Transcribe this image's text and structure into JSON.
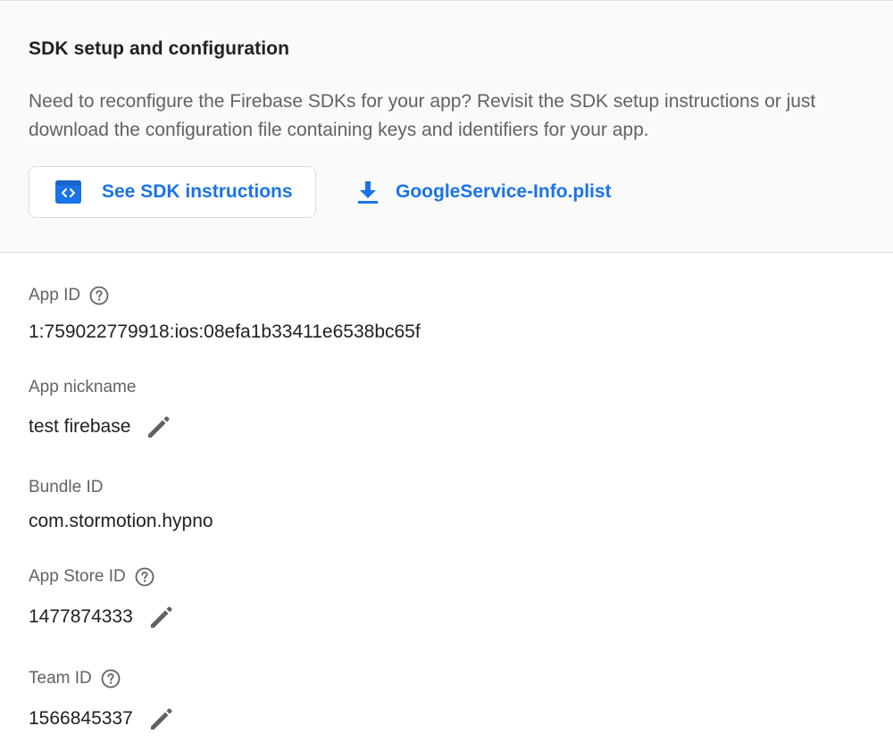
{
  "sdk_section": {
    "title": "SDK setup and configuration",
    "description": "Need to reconfigure the Firebase SDKs for your app? Revisit the SDK setup instructions or just download the configuration file containing keys and identifiers for your app.",
    "sdk_button_label": "See SDK instructions",
    "sdk_button_icon": "code-icon",
    "download_label": "GoogleService-Info.plist",
    "download_icon": "download-icon"
  },
  "fields": {
    "app_id": {
      "label": "App ID",
      "value": "1:759022779918:ios:08efa1b33411e6538bc65f",
      "help_icon": "help-icon"
    },
    "app_nickname": {
      "label": "App nickname",
      "value": "test firebase",
      "edit_icon": "edit-icon"
    },
    "bundle_id": {
      "label": "Bundle ID",
      "value": "com.stormotion.hypno"
    },
    "app_store_id": {
      "label": "App Store ID",
      "value": "1477874333",
      "help_icon": "help-icon",
      "edit_icon": "edit-icon"
    },
    "team_id": {
      "label": "Team ID",
      "value": "1566845337",
      "help_icon": "help-icon",
      "edit_icon": "edit-icon"
    }
  },
  "colors": {
    "accent": "#1a73e8",
    "text_primary": "#202124",
    "text_secondary": "#5f6368",
    "icon_gray": "#616161",
    "top_background": "#fafafa",
    "divider": "#dadce0"
  }
}
